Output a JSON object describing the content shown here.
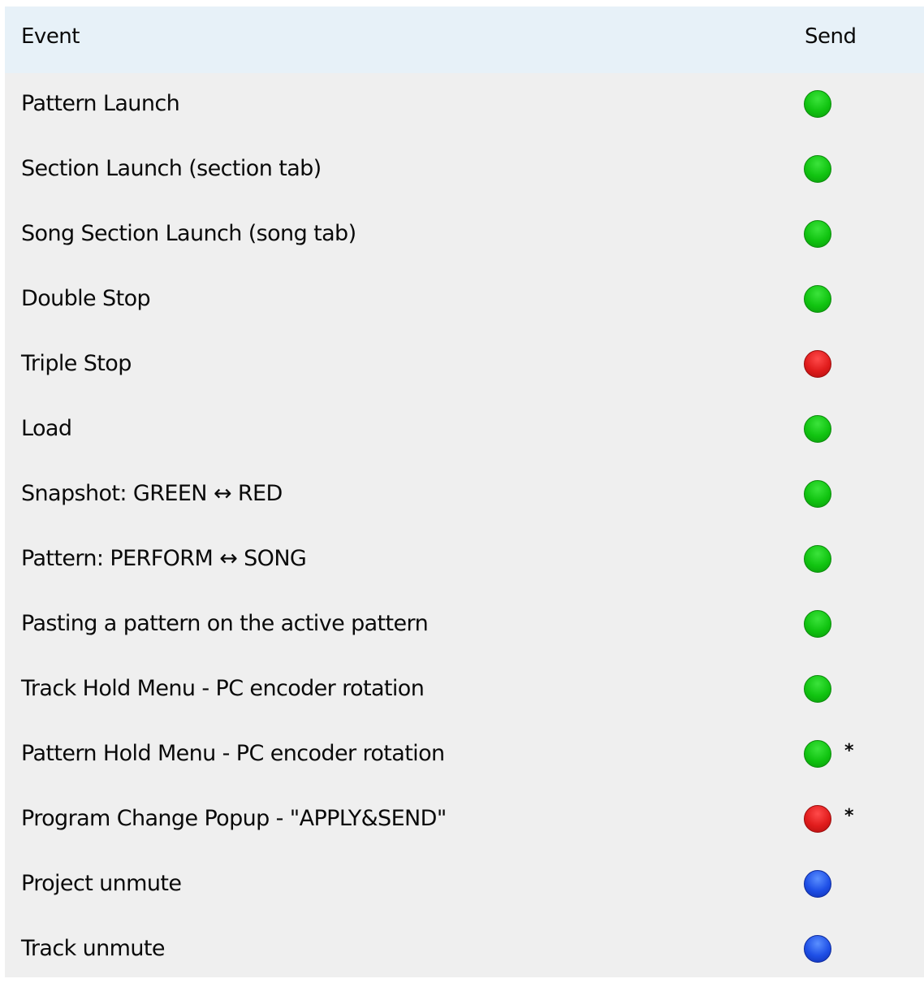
{
  "header": {
    "event_label": "Event",
    "send_label": "Send"
  },
  "rows": [
    {
      "event": "Pattern Launch",
      "send": "green",
      "note": ""
    },
    {
      "event": "Section Launch (section tab)",
      "send": "green",
      "note": ""
    },
    {
      "event": "Song Section Launch (song tab)",
      "send": "green",
      "note": ""
    },
    {
      "event": "Double Stop",
      "send": "green",
      "note": ""
    },
    {
      "event": "Triple Stop",
      "send": "red",
      "note": ""
    },
    {
      "event": "Load",
      "send": "green",
      "note": ""
    },
    {
      "event": "Snapshot: GREEN ↔ RED",
      "send": "green",
      "note": ""
    },
    {
      "event": "Pattern: PERFORM ↔ SONG",
      "send": "green",
      "note": ""
    },
    {
      "event": "Pasting a pattern on the active pattern",
      "send": "green",
      "note": ""
    },
    {
      "event": "Track Hold Menu - PC encoder rotation",
      "send": "green",
      "note": ""
    },
    {
      "event": "Pattern Hold Menu - PC encoder rotation",
      "send": "green",
      "note": "*"
    },
    {
      "event": "Program Change Popup - \"APPLY&SEND\"",
      "send": "red",
      "note": "*"
    },
    {
      "event": "Project unmute",
      "send": "blue",
      "note": ""
    },
    {
      "event": "Track unmute",
      "send": "blue",
      "note": ""
    }
  ],
  "colors": {
    "header_bg": "#e7f1f8",
    "row_bg": "#efefef",
    "green": "#11c411",
    "red": "#e01c1c",
    "blue": "#1e4fe6"
  }
}
